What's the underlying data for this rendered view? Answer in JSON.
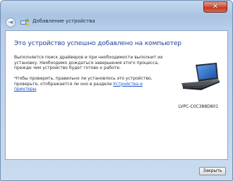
{
  "window": {
    "title": "Добавление устройства",
    "close_glyph": "✕"
  },
  "nav": {
    "back_glyph": "◄"
  },
  "main": {
    "heading": "Это устройство успешно добавлено на компьютер",
    "paragraph1": "Выполняется поиск драйверов и при необходимости выполнит их установку. Необходимо дождаться завершения этого процесса, прежде чем устройство будет готово к работе.",
    "paragraph2_text": "Чтобы проверить, правильно ли установлось это устройство, проверьте, отображается ли оно в разделе ",
    "paragraph2_link": "Устройства и принтеры",
    "paragraph2_end": "."
  },
  "device": {
    "name": "LVPC-C0C388D801",
    "icon": "laptop-icon"
  },
  "footer": {
    "close_label": "Закрыть"
  },
  "colors": {
    "heading": "#1c3f94",
    "link": "#1a55c8",
    "frame": "#a9c3e2",
    "close_red": "#c23a22"
  }
}
